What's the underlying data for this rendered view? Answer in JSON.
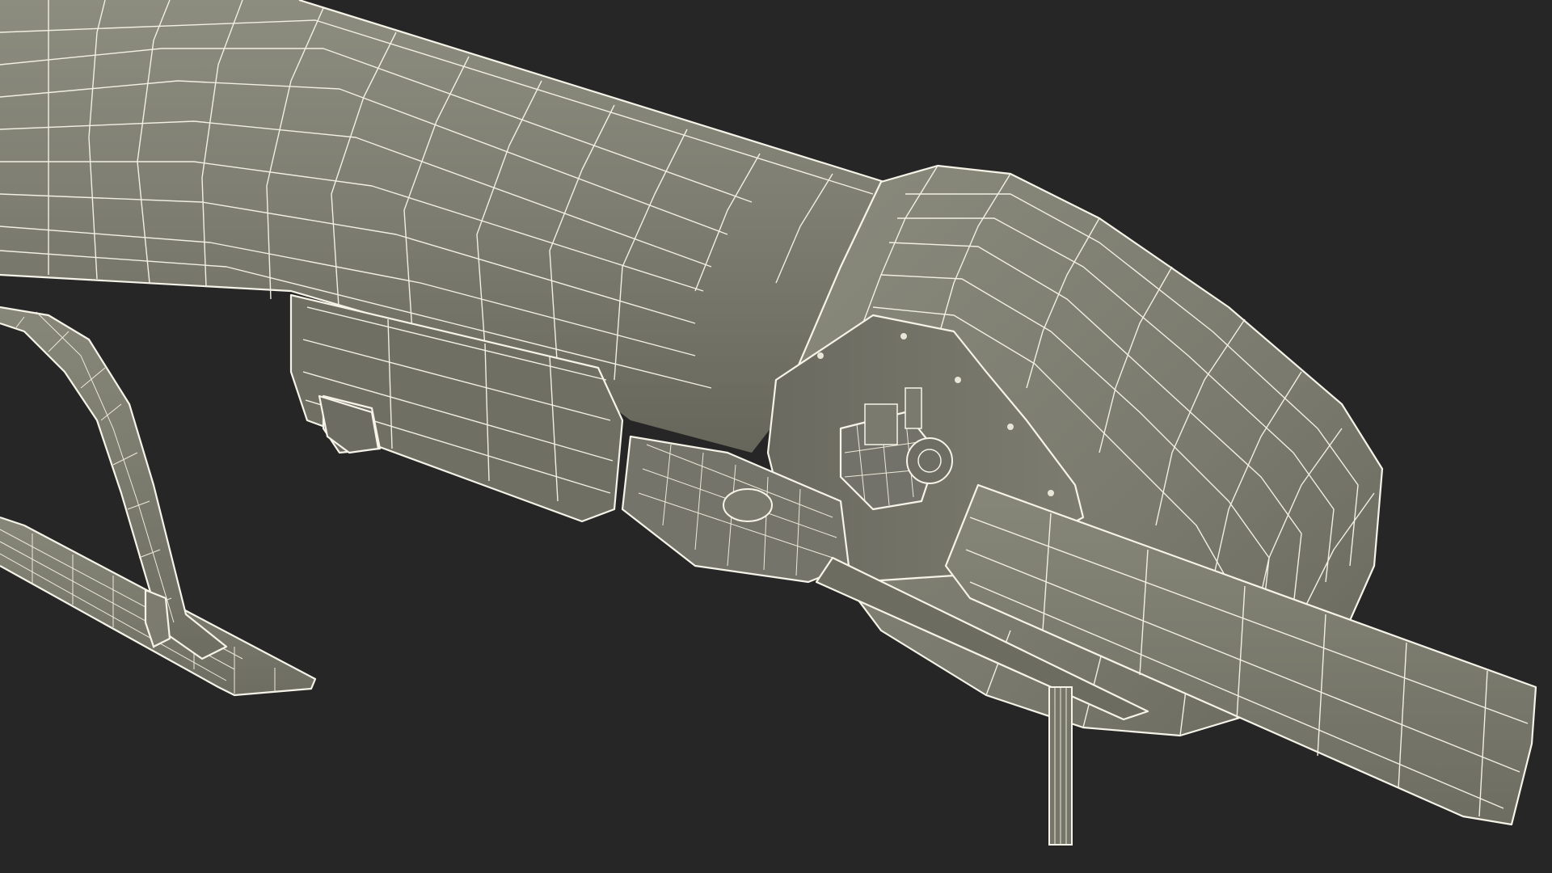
{
  "scene": {
    "subject": "wireframe-3d-model",
    "background_color": "#262626",
    "surface_color": "#7a7a6e",
    "surface_dark_color": "#646459",
    "surface_light_color": "#8a8a7d",
    "wire_color": "#f2f0e4"
  }
}
